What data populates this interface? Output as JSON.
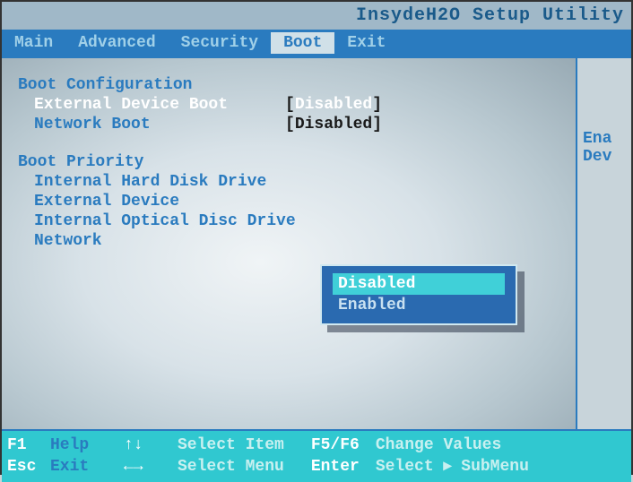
{
  "title": "InsydeH2O Setup Utility",
  "menu": {
    "items": [
      "Main",
      "Advanced",
      "Security",
      "Boot",
      "Exit"
    ],
    "active_index": 3
  },
  "boot_config": {
    "heading": "Boot Configuration",
    "settings": [
      {
        "label": "External Device Boot",
        "value": "Disabled",
        "selected": true
      },
      {
        "label": "Network Boot",
        "value": "Disabled",
        "selected": false
      }
    ]
  },
  "boot_priority": {
    "heading": "Boot Priority",
    "items": [
      "Internal Hard Disk Drive",
      "External Device",
      "Internal Optical Disc Drive",
      "Network"
    ]
  },
  "popup": {
    "options": [
      "Disabled",
      "Enabled"
    ],
    "selected_index": 0
  },
  "help_pane": {
    "line1": "Ena",
    "line2": "Dev"
  },
  "footer": {
    "f1_key": "F1",
    "f1_label": "Help",
    "esc_key": "Esc",
    "esc_label": "Exit",
    "updown_key": "↑↓",
    "updown_desc": "Select Item",
    "leftright_key": "←→",
    "leftright_desc": "Select Menu",
    "f5f6_key": "F5/F6",
    "f5f6_desc": "Change Values",
    "enter_key": "Enter",
    "enter_desc": "Select ▸ SubMenu"
  }
}
